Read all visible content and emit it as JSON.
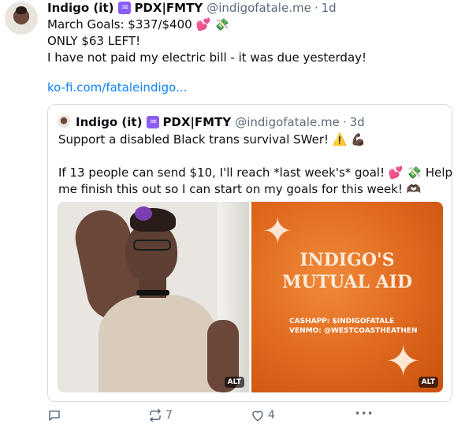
{
  "post": {
    "author_name": "Indigo (it)",
    "flag_glyph": "♒",
    "location": "PDX|FMTY",
    "handle": "@indigofatale.me",
    "separator": "·",
    "time": "1d",
    "lines": [
      "March Goals: $337/$400",
      "ONLY $63 LEFT!",
      "I have not paid my electric bill - it was due yesterday!"
    ],
    "emoji_heart": "💕",
    "emoji_money": "💸",
    "link_text": "ko-fi.com/fataleindigo..."
  },
  "quote": {
    "author_name": "Indigo (it)",
    "flag_glyph": "♒",
    "location": "PDX|FMTY",
    "handle": "@indigofatale.me",
    "separator": "·",
    "time": "3d",
    "line1": "Support a disabled Black trans survival SWer!",
    "line1_emoji_warn": "⚠️",
    "line1_emoji_arm": "💪🏿",
    "line2": "If 13 people can send $10, I'll reach *last week's* goal!",
    "line2_emoji_heart": "💕",
    "line2_emoji_money": "💸",
    "line2_tail": "Help",
    "line3": "me finish this out so I can start on my goals for this week!",
    "line3_emoji": "🫶🏿",
    "images": [
      {
        "alt_badge": "ALT"
      },
      {
        "alt_badge": "ALT",
        "title_line1": "INDIGO'S",
        "title_line2": "MUTUAL AID",
        "info_line1": "CASHAPP: $INDIGOFATALE",
        "info_line2": "VENMO: @WESTCOASTHEATHEN"
      }
    ]
  },
  "actions": {
    "reply_icon": "reply-icon",
    "repost_icon": "repost-icon",
    "repost_count": "7",
    "like_icon": "heart-icon",
    "like_count": "4",
    "more_icon": "more-icon",
    "more_glyph": "•••"
  },
  "colors": {
    "link": "#1083fe",
    "muted": "#5b6b7c",
    "flag": "#8b5cf6",
    "image_orange": "#e06a1f"
  }
}
